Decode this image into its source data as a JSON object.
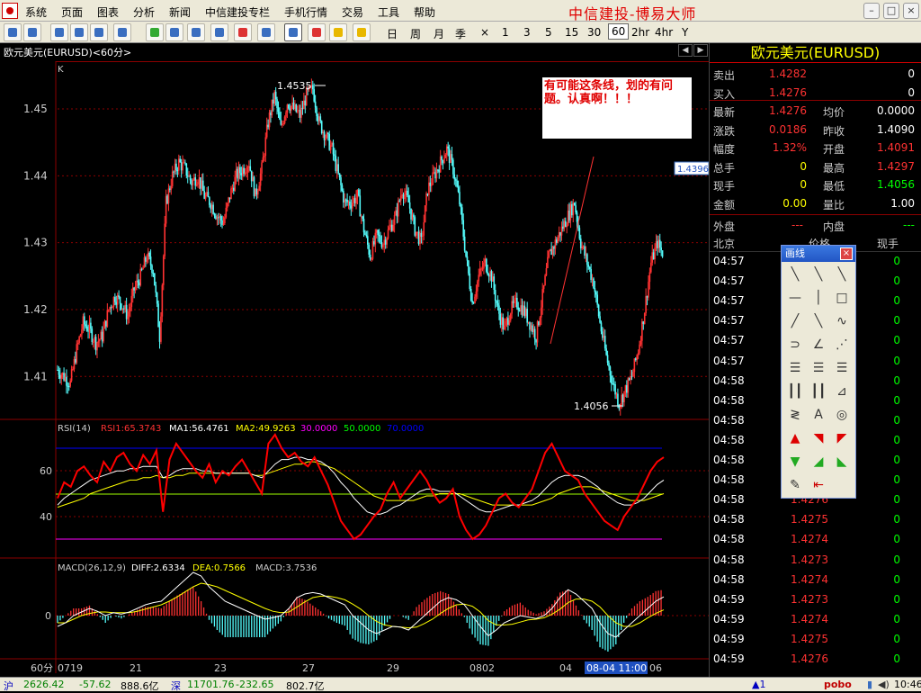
{
  "menubar": {
    "items": [
      "系统",
      "页面",
      "图表",
      "分析",
      "新闻",
      "中信建投专栏",
      "手机行情",
      "交易",
      "工具",
      "帮助"
    ],
    "brand": "中信建投-博易大师"
  },
  "toolbar": {
    "periods": [
      "日",
      "周",
      "月",
      "季",
      "×",
      "1",
      "3",
      "5",
      "15",
      "30",
      "60",
      "2hr",
      "4hr",
      "Y"
    ],
    "selected_period": "60"
  },
  "chart": {
    "title": "欧元美元(EURUSD)<60分>",
    "k_label": "K",
    "high_label": "1.4535",
    "low_label": "1.4056",
    "price_tag": "1.4396",
    "annotation": "有可能这条线，划的有问题。认真啊！！！",
    "price_ticks": [
      "1.45",
      "1.44",
      "1.43",
      "1.42",
      "1.41"
    ],
    "rsi": {
      "header": "RSI(14)",
      "rsi1": "RSI1:65.3743",
      "ma1": "MA1:56.4761",
      "ma2": "MA2:49.9263",
      "l30": "30.0000",
      "l50": "50.0000",
      "l70": "70.0000",
      "ticks": [
        "60",
        "40"
      ]
    },
    "macd": {
      "header": "MACD(26,12,9)",
      "diff": "DIFF:2.6334",
      "dea": "DEA:0.7566",
      "macd": "MACD:3.7536",
      "zero": "0"
    },
    "xaxis": {
      "period": "60分",
      "labels": [
        "0719",
        "21",
        "23",
        "27",
        "29",
        "0802",
        "04"
      ],
      "cursor": "08-04 11:00",
      "trail": "06"
    }
  },
  "chart_data": {
    "type": "candlestick",
    "title": "欧元美元(EURUSD)<60分>",
    "ylim": [
      1.405,
      1.4535
    ],
    "y_ticks": [
      1.45,
      1.44,
      1.43,
      1.42,
      1.41
    ],
    "x_labels": [
      "0719",
      "21",
      "23",
      "27",
      "29",
      "0802",
      "04"
    ],
    "annotations": [
      {
        "label": "1.4535",
        "value": 1.4535
      },
      {
        "label": "1.4056",
        "value": 1.4056
      }
    ],
    "price_trend": [
      1.411,
      1.41,
      1.409,
      1.414,
      1.418,
      1.417,
      1.415,
      1.416,
      1.42,
      1.422,
      1.421,
      1.419,
      1.423,
      1.425,
      1.428,
      1.426,
      1.416,
      1.436,
      1.44,
      1.442,
      1.441,
      1.439,
      1.44,
      1.437,
      1.436,
      1.434,
      1.433,
      1.437,
      1.44,
      1.441,
      1.442,
      1.437,
      1.441,
      1.448,
      1.452,
      1.447,
      1.451,
      1.45,
      1.449,
      1.452,
      1.453,
      1.448,
      1.446,
      1.444,
      1.44,
      1.436,
      1.436,
      1.437,
      1.432,
      1.428,
      1.431,
      1.43,
      1.432,
      1.434,
      1.438,
      1.436,
      1.432,
      1.43,
      1.438,
      1.44,
      1.442,
      1.444,
      1.441,
      1.436,
      1.428,
      1.421,
      1.425,
      1.427,
      1.425,
      1.42,
      1.417,
      1.42,
      1.421,
      1.42,
      1.418,
      1.416,
      1.422,
      1.428,
      1.43,
      1.432,
      1.434,
      1.436,
      1.43,
      1.427,
      1.424,
      1.418,
      1.413,
      1.409,
      1.406,
      1.408,
      1.41,
      1.414,
      1.42,
      1.427,
      1.43,
      1.428
    ],
    "rsi_series": [
      {
        "name": "RSI1",
        "values": [
          48,
          55,
          53,
          60,
          62,
          58,
          55,
          64,
          60,
          66,
          68,
          63,
          60,
          67,
          63,
          69,
          42,
          65,
          72,
          68,
          64,
          60,
          57,
          63,
          55,
          60,
          58,
          62,
          65,
          60,
          55,
          50,
          72,
          76,
          70,
          66,
          68,
          64,
          62,
          66,
          60,
          54,
          46,
          38,
          34,
          30,
          32,
          36,
          40,
          43,
          50,
          55,
          48,
          52,
          56,
          60,
          56,
          50,
          46,
          48,
          52,
          40,
          34,
          30,
          32,
          36,
          42,
          48,
          50,
          46,
          44,
          48,
          52,
          60,
          68,
          72,
          66,
          60,
          58,
          56,
          50,
          46,
          42,
          38,
          36,
          34,
          40,
          44,
          48,
          54,
          60,
          64,
          66
        ]
      },
      {
        "name": "MA1",
        "values": [
          45,
          48,
          50,
          52,
          54,
          56,
          57,
          58,
          59,
          60,
          60,
          61,
          61,
          62,
          62,
          62,
          57,
          58,
          60,
          61,
          61,
          61,
          60,
          60,
          59,
          59,
          59,
          59,
          59,
          59,
          58,
          57,
          60,
          63,
          65,
          65,
          66,
          66,
          65,
          65,
          64,
          62,
          59,
          55,
          52,
          48,
          45,
          42,
          41,
          41,
          42,
          44,
          45,
          47,
          49,
          51,
          52,
          52,
          51,
          51,
          51,
          49,
          47,
          45,
          43,
          42,
          42,
          43,
          44,
          45,
          45,
          46,
          47,
          49,
          52,
          55,
          57,
          58,
          58,
          58,
          57,
          55,
          53,
          50,
          48,
          46,
          45,
          45,
          46,
          48,
          51,
          54,
          56
        ]
      },
      {
        "name": "MA2",
        "values": [
          44,
          45,
          46,
          47,
          48,
          50,
          51,
          52,
          53,
          54,
          55,
          56,
          56,
          57,
          57,
          58,
          57,
          57,
          58,
          58,
          59,
          59,
          59,
          59,
          59,
          59,
          59,
          59,
          59,
          59,
          58,
          58,
          59,
          60,
          61,
          62,
          63,
          63,
          64,
          64,
          63,
          62,
          61,
          59,
          57,
          55,
          53,
          51,
          49,
          48,
          47,
          47,
          47,
          47,
          47,
          48,
          49,
          49,
          50,
          50,
          50,
          50,
          49,
          48,
          47,
          46,
          45,
          45,
          45,
          45,
          45,
          45,
          45,
          46,
          47,
          48,
          50,
          51,
          52,
          53,
          53,
          53,
          52,
          51,
          50,
          49,
          48,
          47,
          47,
          47,
          48,
          49,
          50
        ]
      }
    ],
    "macd_series": [
      {
        "name": "DIFF",
        "values": [
          -1.5,
          -1,
          0,
          0.5,
          1,
          0.6,
          0,
          0.4,
          0.2,
          0.5,
          1,
          1.5,
          1.8,
          2,
          3,
          4,
          5,
          6,
          5.5,
          4,
          3,
          2,
          1.5,
          1,
          0.5,
          0,
          -0.5,
          -0.3,
          0,
          1,
          2.5,
          3,
          3.2,
          3,
          2.5,
          2,
          1.5,
          0,
          -1,
          -2,
          -2.5,
          -2,
          -1.5,
          -1.6,
          -2,
          -1,
          0,
          1,
          2,
          2.5,
          2.2,
          1.5,
          0,
          -1.5,
          -2.8,
          -2,
          -1,
          -0.5,
          0,
          -0.2,
          -0.4,
          0,
          1,
          2.5,
          3.6,
          3,
          2,
          1,
          -1,
          -2.5,
          -3,
          -2,
          -1,
          0,
          1,
          2,
          2.6
        ]
      },
      {
        "name": "DEA",
        "values": [
          -1,
          -1,
          -0.5,
          0,
          0.3,
          0.5,
          0.5,
          0.4,
          0.4,
          0.4,
          0.6,
          0.9,
          1.2,
          1.5,
          2,
          2.6,
          3.3,
          4,
          4.5,
          4.3,
          4,
          3.5,
          3,
          2.5,
          2,
          1.5,
          1,
          0.6,
          0.4,
          0.5,
          1.2,
          1.9,
          2.5,
          2.7,
          2.7,
          2.5,
          2.2,
          1.6,
          0.9,
          0,
          -0.8,
          -1.3,
          -1.5,
          -1.6,
          -1.7,
          -1.6,
          -1.1,
          -0.5,
          0.3,
          1,
          1.5,
          1.6,
          1.3,
          0.5,
          -0.7,
          -1.3,
          -1.3,
          -1.2,
          -0.9,
          -0.6,
          -0.5,
          -0.3,
          0.2,
          0.9,
          1.8,
          2.3,
          2.3,
          2,
          1.2,
          0,
          -1,
          -1.5,
          -1.5,
          -1,
          -0.3,
          0.3,
          0.8
        ]
      }
    ]
  },
  "quote": {
    "title": "欧元美元(EURUSD)",
    "rows": [
      {
        "l1": "卖出",
        "v1": "1.4282",
        "l2": "",
        "v2": "0"
      },
      {
        "l1": "买入",
        "v1": "1.4276",
        "l2": "",
        "v2": "0"
      },
      {
        "l1": "最新",
        "v1": "1.4276",
        "l2": "均价",
        "v2": "0.0000"
      },
      {
        "l1": "涨跌",
        "v1": "0.0186",
        "l2": "昨收",
        "v2": "1.4090"
      },
      {
        "l1": "幅度",
        "v1": "1.32%",
        "l2": "开盘",
        "v2": "1.4091"
      },
      {
        "l1": "总手",
        "v1": "0",
        "l2": "最高",
        "v2": "1.4297"
      },
      {
        "l1": "现手",
        "v1": "0",
        "l2": "最低",
        "v2": "1.4056"
      },
      {
        "l1": "金额",
        "v1": "0.00",
        "l2": "量比",
        "v2": "1.00"
      },
      {
        "l1": "外盘",
        "v1": "---",
        "l2": "内盘",
        "v2": "---"
      }
    ],
    "trade_header": [
      "北京",
      "价格",
      "现手"
    ],
    "trades": [
      {
        "t": "04:57",
        "p": "",
        "v": "0"
      },
      {
        "t": "04:57",
        "p": "",
        "v": "0"
      },
      {
        "t": "04:57",
        "p": "",
        "v": "0"
      },
      {
        "t": "04:57",
        "p": "",
        "v": "0"
      },
      {
        "t": "04:57",
        "p": "",
        "v": "0"
      },
      {
        "t": "04:57",
        "p": "",
        "v": "0"
      },
      {
        "t": "04:58",
        "p": "",
        "v": "0"
      },
      {
        "t": "04:58",
        "p": "",
        "v": "0"
      },
      {
        "t": "04:58",
        "p": "",
        "v": "0"
      },
      {
        "t": "04:58",
        "p": "",
        "v": "0"
      },
      {
        "t": "04:58",
        "p": "",
        "v": "0"
      },
      {
        "t": "04:58",
        "p": "",
        "v": "0"
      },
      {
        "t": "04:58",
        "p": "1.4276",
        "v": "0"
      },
      {
        "t": "04:58",
        "p": "1.4275",
        "v": "0"
      },
      {
        "t": "04:58",
        "p": "1.4274",
        "v": "0"
      },
      {
        "t": "04:58",
        "p": "1.4273",
        "v": "0"
      },
      {
        "t": "04:58",
        "p": "1.4274",
        "v": "0"
      },
      {
        "t": "04:59",
        "p": "1.4273",
        "v": "0"
      },
      {
        "t": "04:59",
        "p": "1.4274",
        "v": "0"
      },
      {
        "t": "04:59",
        "p": "1.4275",
        "v": "0"
      },
      {
        "t": "04:59",
        "p": "1.4276",
        "v": "0"
      }
    ]
  },
  "drawpanel": {
    "title": "画线",
    "close": "×"
  },
  "statusbar": {
    "sh_label": "沪",
    "sh_index": "2626.42",
    "sh_change": "-57.62",
    "sh_amount": "888.6亿",
    "sz_label": "深",
    "sz_index": "11701.76",
    "sz_change": "-232.65",
    "sz_amount": "802.7亿",
    "alert": "▲1",
    "brand": "pobo",
    "time": "10:46"
  },
  "colors": {
    "up": "#ff3232",
    "down": "#54fcfc",
    "accent": "#ffff00",
    "rsi_line": "#ff0000",
    "ma_white": "#ffffff",
    "ma_yellow": "#ffff00"
  }
}
